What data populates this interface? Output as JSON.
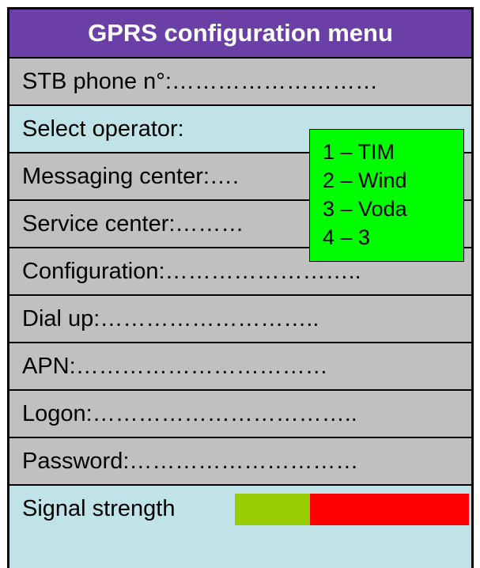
{
  "menu": {
    "title": "GPRS configuration menu",
    "rows": [
      {
        "label": "STB phone n°:",
        "dots": "………………………"
      },
      {
        "label": "Select operator:",
        "dots": ""
      },
      {
        "label": "Messaging center:",
        "dots": "…."
      },
      {
        "label": "Service center:",
        "dots": "………"
      },
      {
        "label": "Configuration:",
        "dots": "…………………….."
      },
      {
        "label": "Dial up:",
        "dots": "……………………….."
      },
      {
        "label": "APN:",
        "dots": "……………………………"
      },
      {
        "label": "Logon:",
        "dots": "…………………………….."
      },
      {
        "label": "Password:",
        "dots": "…………………………"
      }
    ],
    "signal": {
      "label": "Signal strength",
      "level": 0.32,
      "good_color": "#99cc00",
      "bad_color": "#ff0000"
    }
  },
  "operator_dropdown": {
    "options": [
      "1 – TIM",
      "2 – Wind",
      "3 – Voda",
      "4 – 3"
    ],
    "background": "#00ff00"
  }
}
